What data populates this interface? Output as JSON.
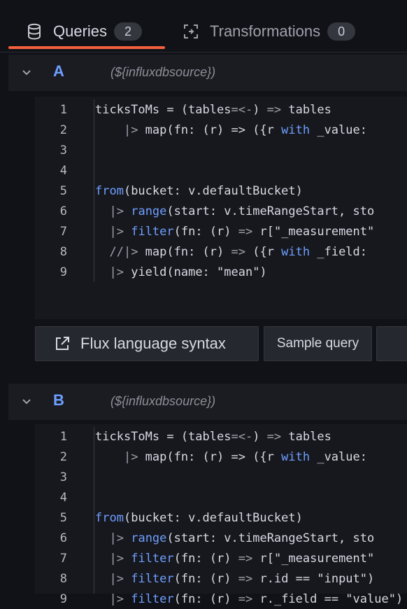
{
  "tabs": [
    {
      "label": "Queries",
      "count": "2",
      "icon": "database-icon",
      "active": true
    },
    {
      "label": "Transformations",
      "count": "0",
      "icon": "transform-icon",
      "active": false
    }
  ],
  "queries": [
    {
      "name": "A",
      "datasource": "(${influxdbsource})",
      "lines": [
        {
          "n": "1",
          "text": "ticksToMs = (tables=<-) => tables"
        },
        {
          "n": "2",
          "text": "    |> map(fn: (r) => ({r with _value:"
        },
        {
          "n": "3",
          "text": ""
        },
        {
          "n": "4",
          "text": ""
        },
        {
          "n": "5",
          "text": "from(bucket: v.defaultBucket)"
        },
        {
          "n": "6",
          "text": "  |> range(start: v.timeRangeStart, sto"
        },
        {
          "n": "7",
          "text": "  |> filter(fn: (r) => r[\"_measurement\""
        },
        {
          "n": "8",
          "text": "  //|> map(fn: (r) => ({r with _field:"
        },
        {
          "n": "9",
          "text": "  |> yield(name: \"mean\")"
        }
      ]
    },
    {
      "name": "B",
      "datasource": "(${influxdbsource})",
      "lines": [
        {
          "n": "1",
          "text": "ticksToMs = (tables=<-) => tables"
        },
        {
          "n": "2",
          "text": "    |> map(fn: (r) => ({r with _value:"
        },
        {
          "n": "3",
          "text": ""
        },
        {
          "n": "4",
          "text": ""
        },
        {
          "n": "5",
          "text": "from(bucket: v.defaultBucket)"
        },
        {
          "n": "6",
          "text": "  |> range(start: v.timeRangeStart, sto"
        },
        {
          "n": "7",
          "text": "  |> filter(fn: (r) => r[\"_measurement\""
        },
        {
          "n": "8",
          "text": "  |> filter(fn: (r) => r.id == \"input\")"
        },
        {
          "n": "9",
          "text": "  |> filter(fn: (r) => r._field == \"value\")"
        }
      ]
    }
  ],
  "help_buttons": {
    "flux_syntax": "Flux language syntax",
    "sample_query": "Sample query"
  },
  "colors": {
    "keyword": "#6e9fff",
    "tab_underline": "#f55f3e",
    "query_name": "#6e9fff"
  }
}
